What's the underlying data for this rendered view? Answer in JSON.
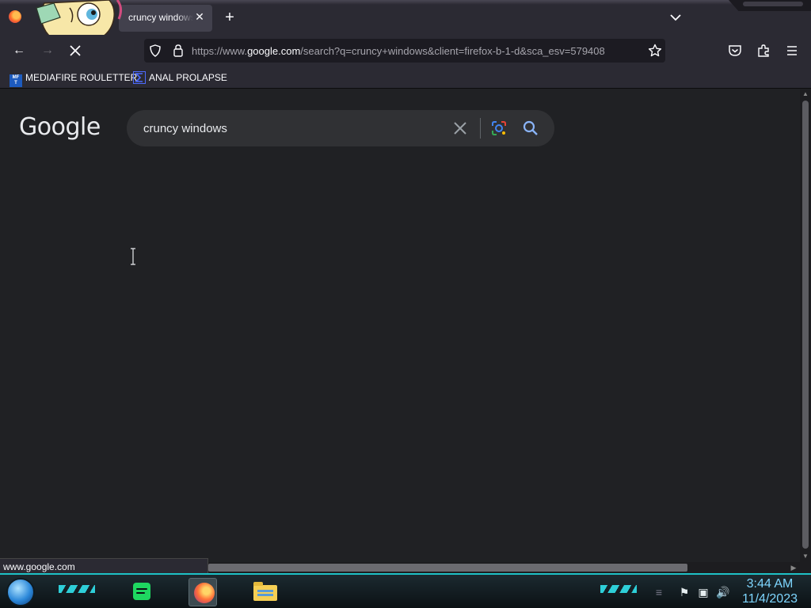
{
  "browser": {
    "tab": {
      "title": "cruncy windows - Google Search",
      "close_icon": "close-icon"
    },
    "new_tab_icon": "plus-icon",
    "url": {
      "prefix": "https://www.",
      "domain": "google.com",
      "rest": "/search?q=cruncy+windows&client=firefox-b-1-d&sca_esv=579408"
    },
    "bookmarks": [
      {
        "label": "MEDIAFIRE ROULETTER",
        "icon_text": "MF\nT"
      },
      {
        "label": "ANAL PROLAPSE"
      }
    ],
    "status_text": "www.google.com"
  },
  "page": {
    "logo": "Google",
    "search_query": "cruncy windows"
  },
  "taskbar": {
    "time": "3:44 AM",
    "date": "11/4/2023"
  },
  "colors": {
    "accent": "#1ec1c6",
    "page_bg": "#202124",
    "chrome_bg": "#2b2a33"
  }
}
